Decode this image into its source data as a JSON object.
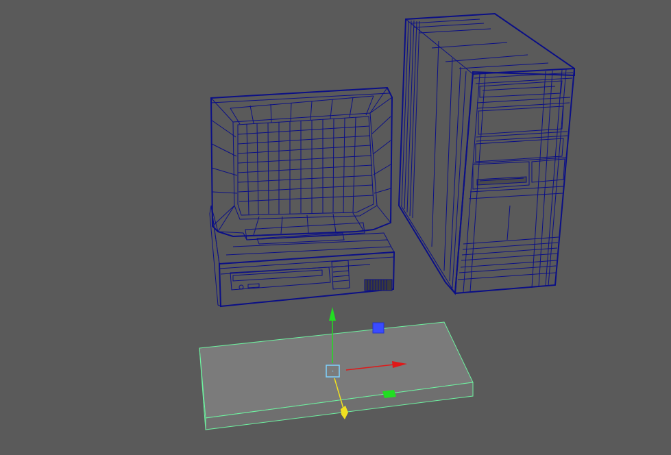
{
  "viewport": {
    "background_color": "#5a5a5a",
    "wireframe_color": "#0b0f86",
    "surface_color": "#7b7b7b",
    "dark_surface_color": "#2b2b2b"
  },
  "scene_objects": [
    {
      "name": "crt-monitor",
      "type": "mesh",
      "display": "wireframe-on-shaded"
    },
    {
      "name": "desktop-base-unit",
      "type": "mesh",
      "display": "wireframe-on-shaded"
    },
    {
      "name": "tower-case",
      "type": "mesh",
      "display": "wireframe-on-shaded"
    },
    {
      "name": "keyboard-slab",
      "type": "mesh",
      "display": "selected",
      "selection_color": "#6ef2a0"
    }
  ],
  "manipulator": {
    "tool": "move",
    "x_axis_color": "#e01818",
    "y_axis_color": "#22dd22",
    "z_axis_color": "#f0e020",
    "center_color": "#7fd3ff",
    "xy_plane_handle_color": "#3a4bff",
    "yz_plane_handle_color": "#22dd22"
  }
}
